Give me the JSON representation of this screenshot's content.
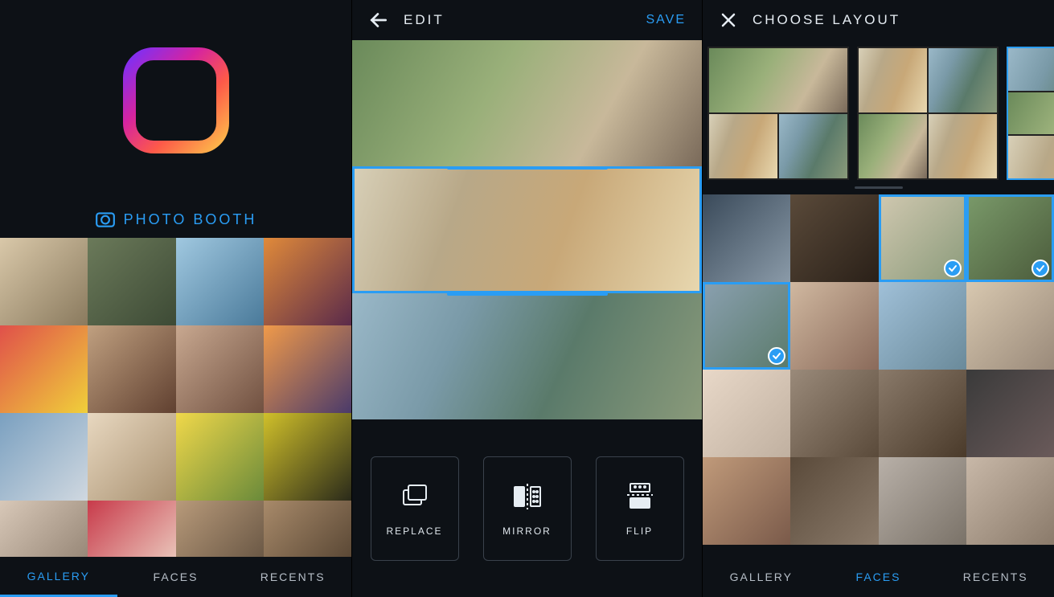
{
  "panel1": {
    "photo_booth_label": "PHOTO BOOTH",
    "tabs": {
      "gallery": "GALLERY",
      "faces": "FACES",
      "recents": "RECENTS",
      "active": "gallery"
    },
    "thumbs": [
      "dog-on-tile",
      "rock-cliff",
      "palm-beach",
      "sunset-silhouettes",
      "balloons",
      "woman-hat-1",
      "woman-hat-2",
      "sunset-palm",
      "blue-house",
      "pastries-box",
      "yellow-flowers",
      "yellow-leaves-bike",
      "coffee-hands",
      "raspberry-tart",
      "puppy-1",
      "puppy-2"
    ]
  },
  "panel2": {
    "title": "EDIT",
    "save_label": "SAVE",
    "strips": [
      {
        "id": "friends-grass-top",
        "selected": false
      },
      {
        "id": "three-friends-profile",
        "selected": true
      },
      {
        "id": "selfie-park",
        "selected": false
      }
    ],
    "tools": {
      "replace": "REPLACE",
      "mirror": "MIRROR",
      "flip": "FLIP"
    }
  },
  "panel3": {
    "title": "CHOOSE LAYOUT",
    "layouts": [
      {
        "pattern": "1-2",
        "selected": false
      },
      {
        "pattern": "2x2",
        "selected": false
      },
      {
        "pattern": "3rows",
        "selected": true
      }
    ],
    "thumbs": [
      {
        "id": "sunglasses-duo",
        "selected": false
      },
      {
        "id": "curly-portrait",
        "selected": false
      },
      {
        "id": "three-friends-profile",
        "selected": true
      },
      {
        "id": "friends-grass",
        "selected": true
      },
      {
        "id": "selfie-park",
        "selected": true
      },
      {
        "id": "friends-sunset",
        "selected": false
      },
      {
        "id": "beach-palm",
        "selected": false
      },
      {
        "id": "two-women-beach",
        "selected": false
      },
      {
        "id": "woman-field",
        "selected": false
      },
      {
        "id": "funny-faces-group",
        "selected": false
      },
      {
        "id": "funny-faces-2",
        "selected": false
      },
      {
        "id": "man-dark",
        "selected": false
      },
      {
        "id": "woman-auburn",
        "selected": false
      },
      {
        "id": "group-dinner",
        "selected": false
      },
      {
        "id": "friends-bw",
        "selected": false
      },
      {
        "id": "woman-dog-bed",
        "selected": false
      }
    ],
    "tabs": {
      "gallery": "GALLERY",
      "faces": "FACES",
      "recents": "RECENTS",
      "active": "faces"
    }
  },
  "colors": {
    "accent": "#2a9df4",
    "bg": "#0d1116"
  },
  "palette": [
    "linear-gradient(135deg,#d9c8a9,#8a7a5e)",
    "linear-gradient(135deg,#6b7a5a,#3d4a35)",
    "linear-gradient(135deg,#a0c8e0,#4a7a9a)",
    "linear-gradient(135deg,#e08a3a,#5a2a4a)",
    "linear-gradient(135deg,#e0504a,#f0d03a)",
    "linear-gradient(135deg,#c0a080,#604030)",
    "linear-gradient(135deg,#c8a890,#705040)",
    "linear-gradient(135deg,#f09a4a,#4a3a6a)",
    "linear-gradient(135deg,#7aa0c0,#d0d8e0)",
    "linear-gradient(135deg,#e8d8c0,#a89070)",
    "linear-gradient(135deg,#f0d84a,#6a8a3a)",
    "linear-gradient(135deg,#d0c02a,#2a2a1a)",
    "linear-gradient(135deg,#d8c8b8,#8a7a6a)",
    "linear-gradient(135deg,#c83a4a,#f0e0d0)",
    "linear-gradient(135deg,#b89a7a,#5a4a3a)",
    "linear-gradient(135deg,#a88a6a,#4a3a2a)"
  ],
  "palette3": [
    "linear-gradient(135deg,#3a4a5a,#8a9aa8)",
    "linear-gradient(135deg,#5a4a3a,#2a2018)",
    "linear-gradient(135deg,#d0c8b0,#8a9a7a)",
    "linear-gradient(135deg,#7a9a6a,#4a5a3a)",
    "linear-gradient(135deg,#8aa0b0,#5a7a6a)",
    "linear-gradient(135deg,#d0b8a0,#8a6a5a)",
    "linear-gradient(135deg,#a0c0d8,#6a8a9a)",
    "linear-gradient(135deg,#d8c8b0,#9a8a7a)",
    "linear-gradient(135deg,#e8d8c8,#c0b0a0)",
    "linear-gradient(135deg,#9a8a7a,#5a4a3a)",
    "linear-gradient(135deg,#8a7a6a,#4a3a2a)",
    "linear-gradient(135deg,#3a3a3a,#6a5a5a)",
    "linear-gradient(135deg,#c09a7a,#7a5a4a)",
    "linear-gradient(135deg,#5a4a3a,#8a7a6a)",
    "linear-gradient(135deg,#b8b0a8,#7a7268)",
    "linear-gradient(135deg,#c8b8a8,#8a7a6a)"
  ],
  "strip_bg": [
    "linear-gradient(120deg,#6a8a5a 0%,#9ab07a 40%,#c8b89a 70%,#7a6a5a 100%)",
    "linear-gradient(110deg,#d8d0b8 0%,#b8a888 30%,#c8a878 60%,#e8d8b0 100%)",
    "linear-gradient(115deg,#9ab8c8 0%,#7a9aa8 30%,#5a7a6a 60%,#8a9a7a 100%)"
  ]
}
